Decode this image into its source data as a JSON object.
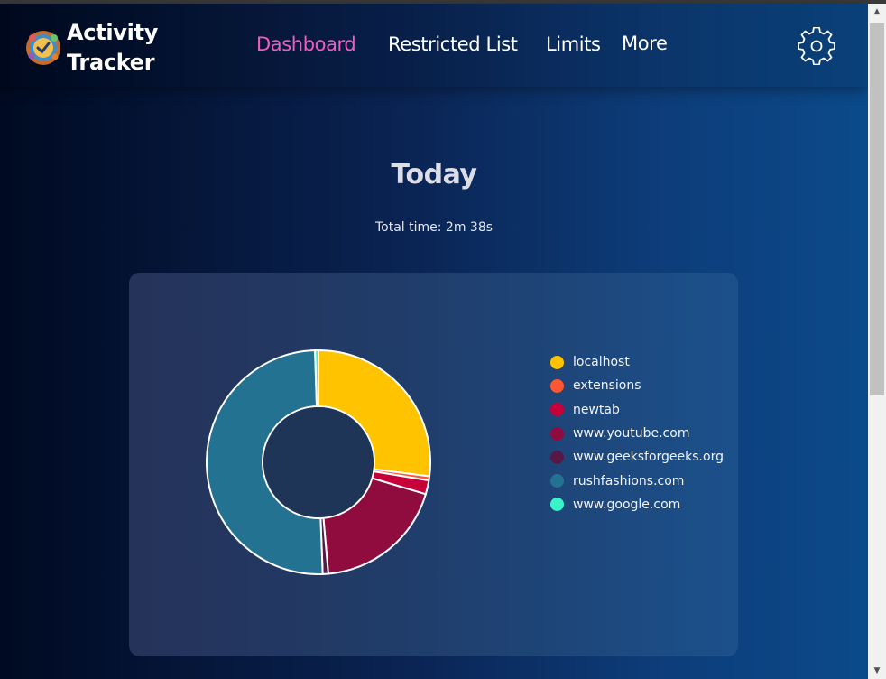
{
  "app": {
    "brand_line1": "Activity",
    "brand_line2": "Tracker"
  },
  "nav": {
    "items": [
      {
        "label": "Dashboard",
        "active": true
      },
      {
        "label": "Restricted List",
        "active": false
      },
      {
        "label": "Limits",
        "active": false
      },
      {
        "label": "More",
        "active": false
      }
    ],
    "settings_icon": "gear-icon",
    "active_color": "#ee5ec0"
  },
  "main": {
    "title": "Today",
    "total_time": "Total time: 2m 38s"
  },
  "chart_data": {
    "type": "pie",
    "donut": true,
    "legend_position": "right",
    "series": [
      {
        "name": "localhost",
        "value": 27.0,
        "color": "#ffc300"
      },
      {
        "name": "extensions",
        "value": 0.6,
        "color": "#ff5733"
      },
      {
        "name": "newtab",
        "value": 2.0,
        "color": "#c70039"
      },
      {
        "name": "www.youtube.com",
        "value": 19.0,
        "color": "#900c3f"
      },
      {
        "name": "www.geeksforgeeks.org",
        "value": 0.8,
        "color": "#581845"
      },
      {
        "name": "rushfashions.com",
        "value": 50.1,
        "color": "#247292"
      },
      {
        "name": "www.google.com",
        "value": 0.5,
        "color": "#36f5c9"
      }
    ]
  }
}
